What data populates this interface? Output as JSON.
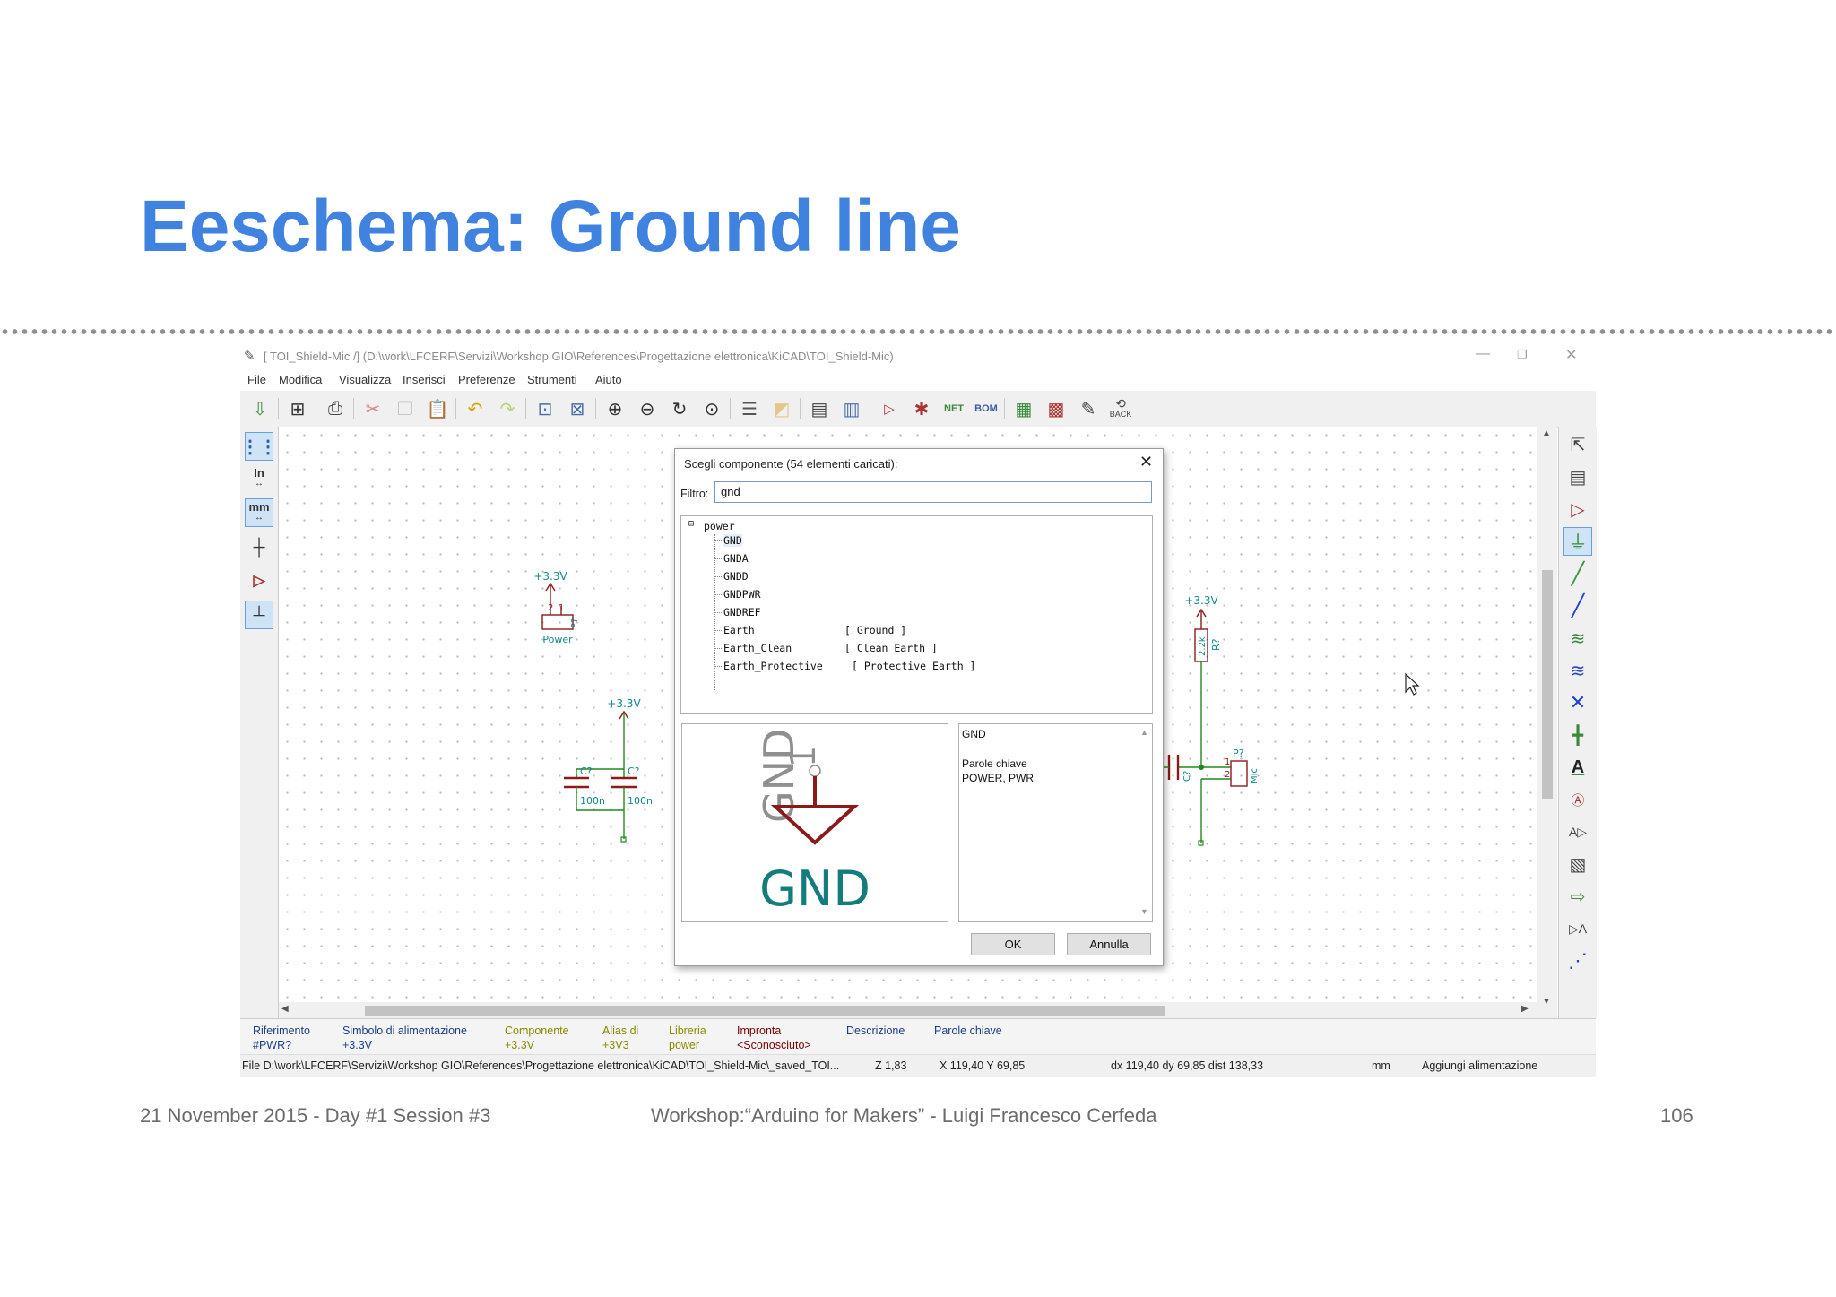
{
  "slide": {
    "title": "Eeschema: Ground line",
    "footer_left": "21 November 2015 - Day #1 Session #3",
    "footer_center": "Workshop:“Arduino for Makers” - Luigi Francesco Cerfeda",
    "page_number": "106"
  },
  "window": {
    "title": "[ TOI_Shield-Mic /] (D:\\work\\LFCERF\\Servizi\\Workshop GIO\\References\\Progettazione elettronica\\KiCAD\\TOI_Shield-Mic)",
    "menu": [
      "File",
      "Modifica",
      "Visualizza",
      "Inserisci",
      "Preferenze",
      "Strumenti",
      "Aiuto"
    ],
    "toolbar_back_label": "BACK",
    "left_toolbar": {
      "in_label": "In",
      "mm_label": "mm"
    }
  },
  "schematic": {
    "power_label": "+3.3V",
    "power_ref": "P?",
    "power_value": "Power",
    "pin_1": "1",
    "pin_2": "2",
    "cap_ref": "C?",
    "cap_value": "100n",
    "res_ref": "R?",
    "res_value_top": "2.2k",
    "res_value_bottom": "10k",
    "mic_ref": "P?",
    "mic_value": "Mic",
    "right_cap_value": "100n",
    "right_cap_ref": "C?"
  },
  "dialog": {
    "title": "Scegli componente (54 elementi caricati):",
    "filter_label": "Filtro:",
    "filter_value": "gnd",
    "tree": {
      "library": "power",
      "items": [
        {
          "name": "GND",
          "desc": ""
        },
        {
          "name": "GNDA",
          "desc": ""
        },
        {
          "name": "GNDD",
          "desc": ""
        },
        {
          "name": "GNDPWR",
          "desc": ""
        },
        {
          "name": "GNDREF",
          "desc": ""
        },
        {
          "name": "Earth",
          "desc": "[ Ground ]"
        },
        {
          "name": "Earth_Clean",
          "desc": "[ Clean Earth ]"
        },
        {
          "name": "Earth_Protective",
          "desc": "[ Protective Earth ]"
        }
      ]
    },
    "preview": {
      "ref_text": "GND",
      "pin_text": "1",
      "value_text": "GND"
    },
    "info": {
      "name": "GND",
      "keywords_label": "Parole chiave",
      "keywords": "POWER, PWR"
    },
    "ok_label": "OK",
    "cancel_label": "Annulla"
  },
  "infobar": {
    "columns": [
      {
        "label": "Riferimento",
        "value": "#PWR?",
        "color": "#1a3f86"
      },
      {
        "label": "Simbolo di alimentazione",
        "value": "+3.3V",
        "color": "#1a3f86"
      },
      {
        "label": "Componente",
        "value": "+3.3V",
        "color": "#8a8a00"
      },
      {
        "label": "Alias di",
        "value": "+3V3",
        "color": "#8a8a00"
      },
      {
        "label": "Libreria",
        "value": "power",
        "color": "#8a8a00"
      },
      {
        "label": "Impronta",
        "value": "<Sconosciuto>",
        "color": "#7a0000"
      },
      {
        "label": "Descrizione",
        "value": "",
        "color": "#1a3f86"
      },
      {
        "label": "Parole chiave",
        "value": "",
        "color": "#1a3f86"
      }
    ]
  },
  "statusbar": {
    "file": "File D:\\work\\LFCERF\\Servizi\\Workshop GIO\\References\\Progettazione elettronica\\KiCAD\\TOI_Shield-Mic\\_saved_TOI...",
    "zoom": "Z 1,83",
    "coords": "X 119,40  Y 69,85",
    "delta": "dx 119,40  dy 69,85  dist 138,33",
    "units": "mm",
    "mode": "Aggiungi alimentazione"
  },
  "colors": {
    "title_blue": "#3f82e0",
    "wire_green": "#1e8a1e",
    "symbol_red": "#8b1a1a",
    "text_teal": "#0f8a8a",
    "ground_teal": "#137d7d"
  }
}
